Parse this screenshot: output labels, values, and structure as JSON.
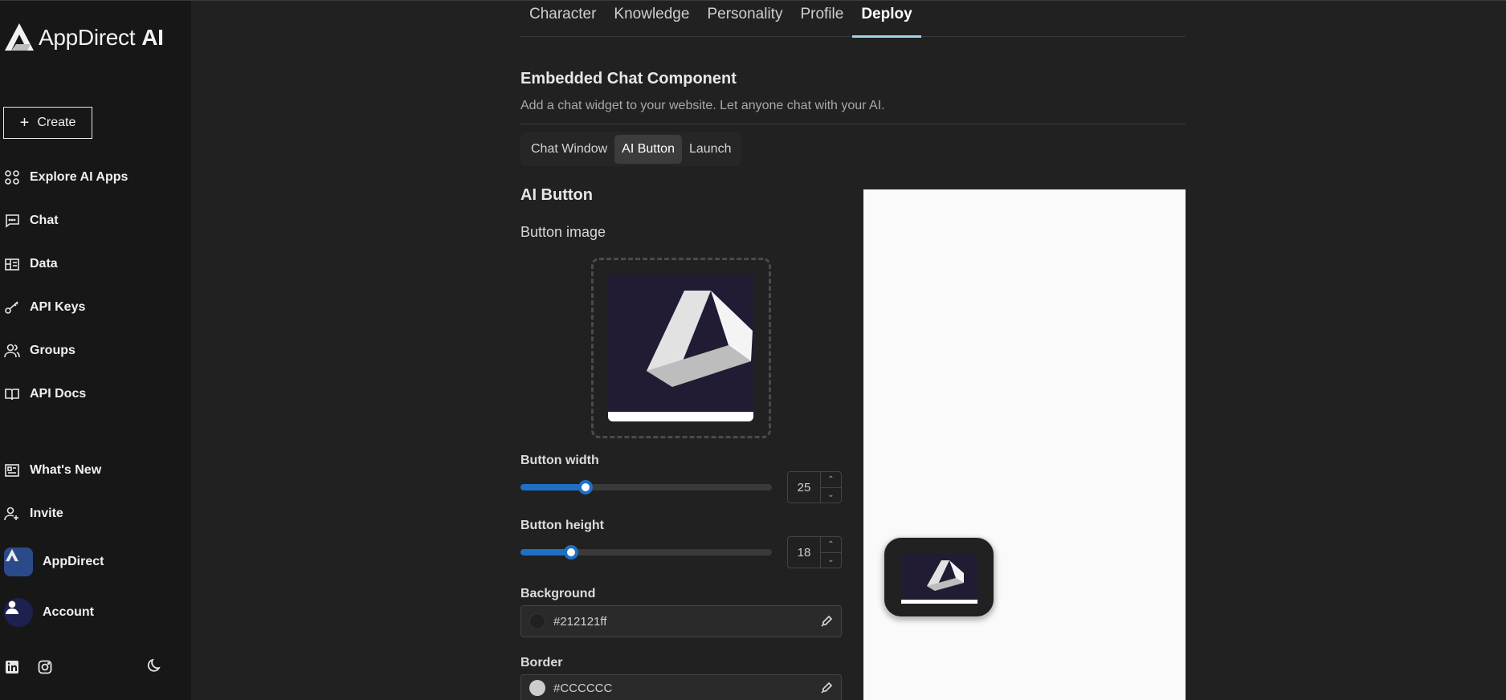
{
  "brand": {
    "name": "AppDirect",
    "suffix": "AI"
  },
  "sidebar": {
    "create_label": "Create",
    "items": [
      {
        "label": "Explore AI Apps",
        "icon": "apps-icon"
      },
      {
        "label": "Chat",
        "icon": "chat-icon"
      },
      {
        "label": "Data",
        "icon": "data-icon"
      },
      {
        "label": "API Keys",
        "icon": "key-icon"
      },
      {
        "label": "Groups",
        "icon": "groups-icon"
      },
      {
        "label": "API Docs",
        "icon": "book-icon"
      }
    ],
    "lower_items": [
      {
        "label": "What's New",
        "icon": "news-icon"
      },
      {
        "label": "Invite",
        "icon": "invite-icon"
      }
    ],
    "org_label": "AppDirect",
    "account_label": "Account",
    "footer_icons": [
      "linkedin-icon",
      "instagram-icon",
      "moon-icon"
    ]
  },
  "tabs": [
    {
      "label": "Character",
      "active": false
    },
    {
      "label": "Knowledge",
      "active": false
    },
    {
      "label": "Personality",
      "active": false
    },
    {
      "label": "Profile",
      "active": false
    },
    {
      "label": "Deploy",
      "active": true
    }
  ],
  "main": {
    "section_title": "Embedded Chat Component",
    "section_subtitle": "Add a chat widget to your website. Let anyone chat with your AI.",
    "subtabs": [
      {
        "label": "Chat Window",
        "active": false
      },
      {
        "label": "AI Button",
        "active": true
      },
      {
        "label": "Launch",
        "active": false
      }
    ],
    "heading": "AI Button",
    "image_label": "Button image",
    "width": {
      "label": "Button width",
      "value": "25",
      "fraction": 0.26
    },
    "height": {
      "label": "Button height",
      "value": "18",
      "fraction": 0.2
    },
    "background": {
      "label": "Background",
      "value": "#212121ff",
      "swatch": "#212121"
    },
    "border": {
      "label": "Border",
      "value": "#CCCCCC",
      "swatch": "#cccccc"
    }
  },
  "colors": {
    "accent": "#1f6fc5",
    "tab_underline": "#9fd4e6",
    "sidebar_bg": "#171717",
    "page_bg": "#212121"
  }
}
